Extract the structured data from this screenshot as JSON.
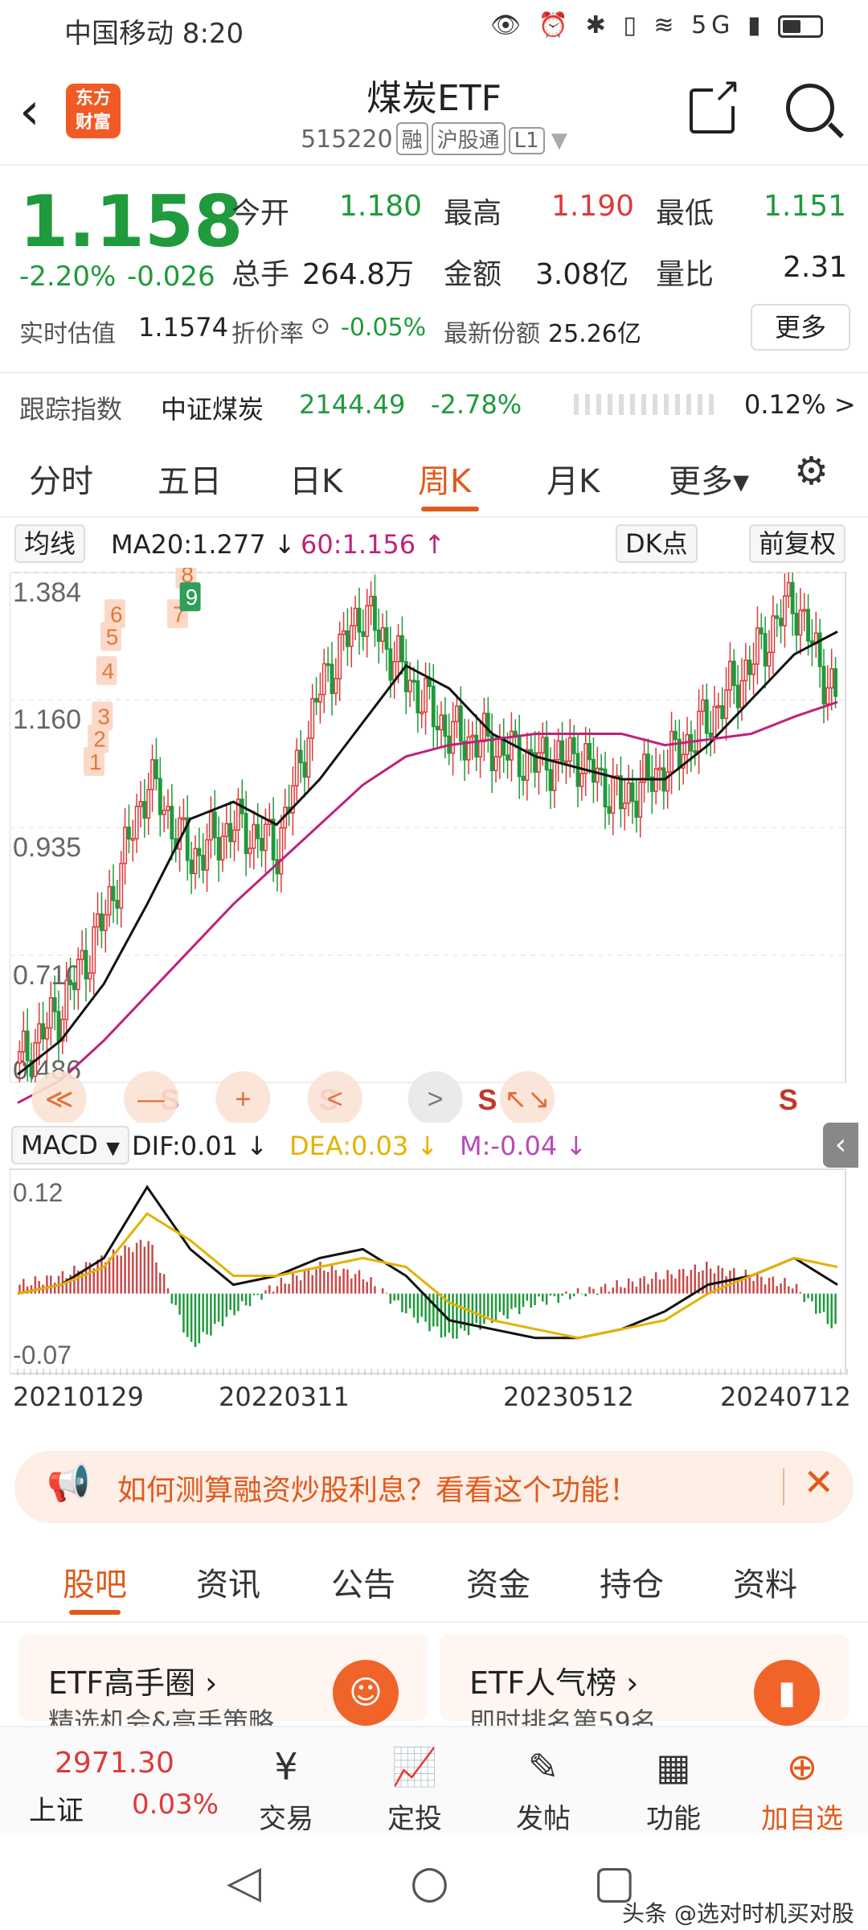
{
  "status_bar": {
    "carrier_time": "中国移动 8:20",
    "right_icons": "👁 ⏰ ✱ ▯ ≋ 5G ▮"
  },
  "header": {
    "title": "煤炭ETF",
    "code": "515220",
    "tag_margin": "融",
    "tag_connect": "沪股通",
    "tag_level": "L1",
    "logo_line1": "东方",
    "logo_line2": "财富"
  },
  "quote": {
    "price": "1.158",
    "change_pct": "-2.20%",
    "change": "-0.026",
    "open_label": "今开",
    "open": "1.180",
    "high_label": "最高",
    "high": "1.190",
    "low_label": "最低",
    "low": "1.151",
    "volume_label": "总手",
    "volume": "264.8万",
    "amount_label": "金额",
    "amount": "3.08亿",
    "ratio_label": "量比",
    "ratio": "2.31",
    "est_label": "实时估值",
    "est": "1.1574",
    "premium_label": "折价率",
    "premium": "-0.05%",
    "share_label": "最新份额",
    "share": "25.26亿",
    "more": "更多",
    "track_label": "跟踪指数",
    "track_name": "中证煤炭",
    "track_value": "2144.49",
    "track_pct": "-2.78%",
    "track_right": "0.12% >"
  },
  "tabs": [
    "分时",
    "五日",
    "日K",
    "周K",
    "月K",
    "更多▾"
  ],
  "chart_bar": {
    "indicator": "均线",
    "ma20": "MA20:1.277 ↓",
    "ma60": "60:1.156 ↑",
    "dk": "DK点",
    "adjust": "前复权"
  },
  "colors": {
    "up": "#e03838",
    "down": "#1f9a3c",
    "accent": "#e05a1c",
    "ma20": "#111111",
    "ma60": "#c0227a"
  },
  "chart_data": {
    "type": "line",
    "yticks": [
      "1.384",
      "1.160",
      "0.935",
      "0.710",
      "0.486"
    ],
    "ylim": [
      0.486,
      1.384
    ],
    "x": [
      "20210129",
      "20220311",
      "20230512",
      "20240712"
    ],
    "series": [
      {
        "name": "MA20",
        "values": [
          0.5,
          0.56,
          0.66,
          0.8,
          0.95,
          0.98,
          0.94,
          1.02,
          1.12,
          1.22,
          1.18,
          1.1,
          1.06,
          1.04,
          1.02,
          1.02,
          1.08,
          1.16,
          1.24,
          1.28
        ]
      },
      {
        "name": "60",
        "values": [
          0.45,
          0.49,
          0.56,
          0.64,
          0.72,
          0.8,
          0.87,
          0.94,
          1.01,
          1.06,
          1.08,
          1.09,
          1.1,
          1.1,
          1.1,
          1.08,
          1.09,
          1.1,
          1.13,
          1.156
        ]
      }
    ],
    "close": [
      0.52,
      0.62,
      0.78,
      1.02,
      0.88,
      0.94,
      0.9,
      1.18,
      1.32,
      1.2,
      1.1,
      1.08,
      1.05,
      1.06,
      0.98,
      1.04,
      1.12,
      1.22,
      1.34,
      1.158
    ],
    "buttons": [
      "≪",
      "—",
      "+",
      "<",
      ">",
      "↖↘"
    ],
    "markers": [
      "S",
      "S",
      "S",
      "S"
    ],
    "labels": [
      "1",
      "2",
      "3",
      "4",
      "5",
      "6",
      "7",
      "8",
      "9"
    ],
    "macd": {
      "indicator": "MACD",
      "dif": "DIF:0.01 ↓",
      "dea": "DEA:0.03 ↓",
      "m": "M:-0.04 ↓",
      "yticks": [
        "0.12",
        "-0.07"
      ],
      "ylim": [
        -0.09,
        0.14
      ],
      "dif_values": [
        0.0,
        0.01,
        0.04,
        0.12,
        0.05,
        0.01,
        0.02,
        0.04,
        0.05,
        0.02,
        -0.03,
        -0.04,
        -0.05,
        -0.05,
        -0.04,
        -0.02,
        0.01,
        0.02,
        0.04,
        0.01
      ],
      "dea_values": [
        0.0,
        0.01,
        0.03,
        0.09,
        0.06,
        0.02,
        0.02,
        0.03,
        0.04,
        0.03,
        -0.01,
        -0.03,
        -0.04,
        -0.05,
        -0.04,
        -0.03,
        0.0,
        0.02,
        0.04,
        0.03
      ],
      "m_values": [
        0.01,
        0.02,
        0.04,
        0.06,
        -0.06,
        -0.02,
        0.01,
        0.03,
        0.02,
        -0.02,
        -0.05,
        -0.03,
        -0.01,
        0.0,
        0.01,
        0.02,
        0.03,
        0.02,
        0.01,
        -0.04
      ]
    }
  },
  "banner": {
    "text": "如何测算融资炒股利息？看看这个功能！",
    "close": "✕"
  },
  "subtabs": [
    "股吧",
    "资讯",
    "公告",
    "资金",
    "持仓",
    "资料"
  ],
  "cards": [
    {
      "title": "ETF高手圈 ›",
      "sub": "精选机会&高手策略"
    },
    {
      "title": "ETF人气榜 ›",
      "sub": "即时排名第59名"
    }
  ],
  "toolbar": {
    "index_value": "2971.30",
    "index_name": "上证",
    "index_pct": "0.03%",
    "items": [
      {
        "icon": "¥",
        "label": "交易"
      },
      {
        "icon": "📈",
        "label": "定投"
      },
      {
        "icon": "✎",
        "label": "发帖"
      },
      {
        "icon": "▦",
        "label": "功能"
      },
      {
        "icon": "⊕",
        "label": "加自选"
      }
    ]
  },
  "watermark": "头条 @选对时机买对股"
}
